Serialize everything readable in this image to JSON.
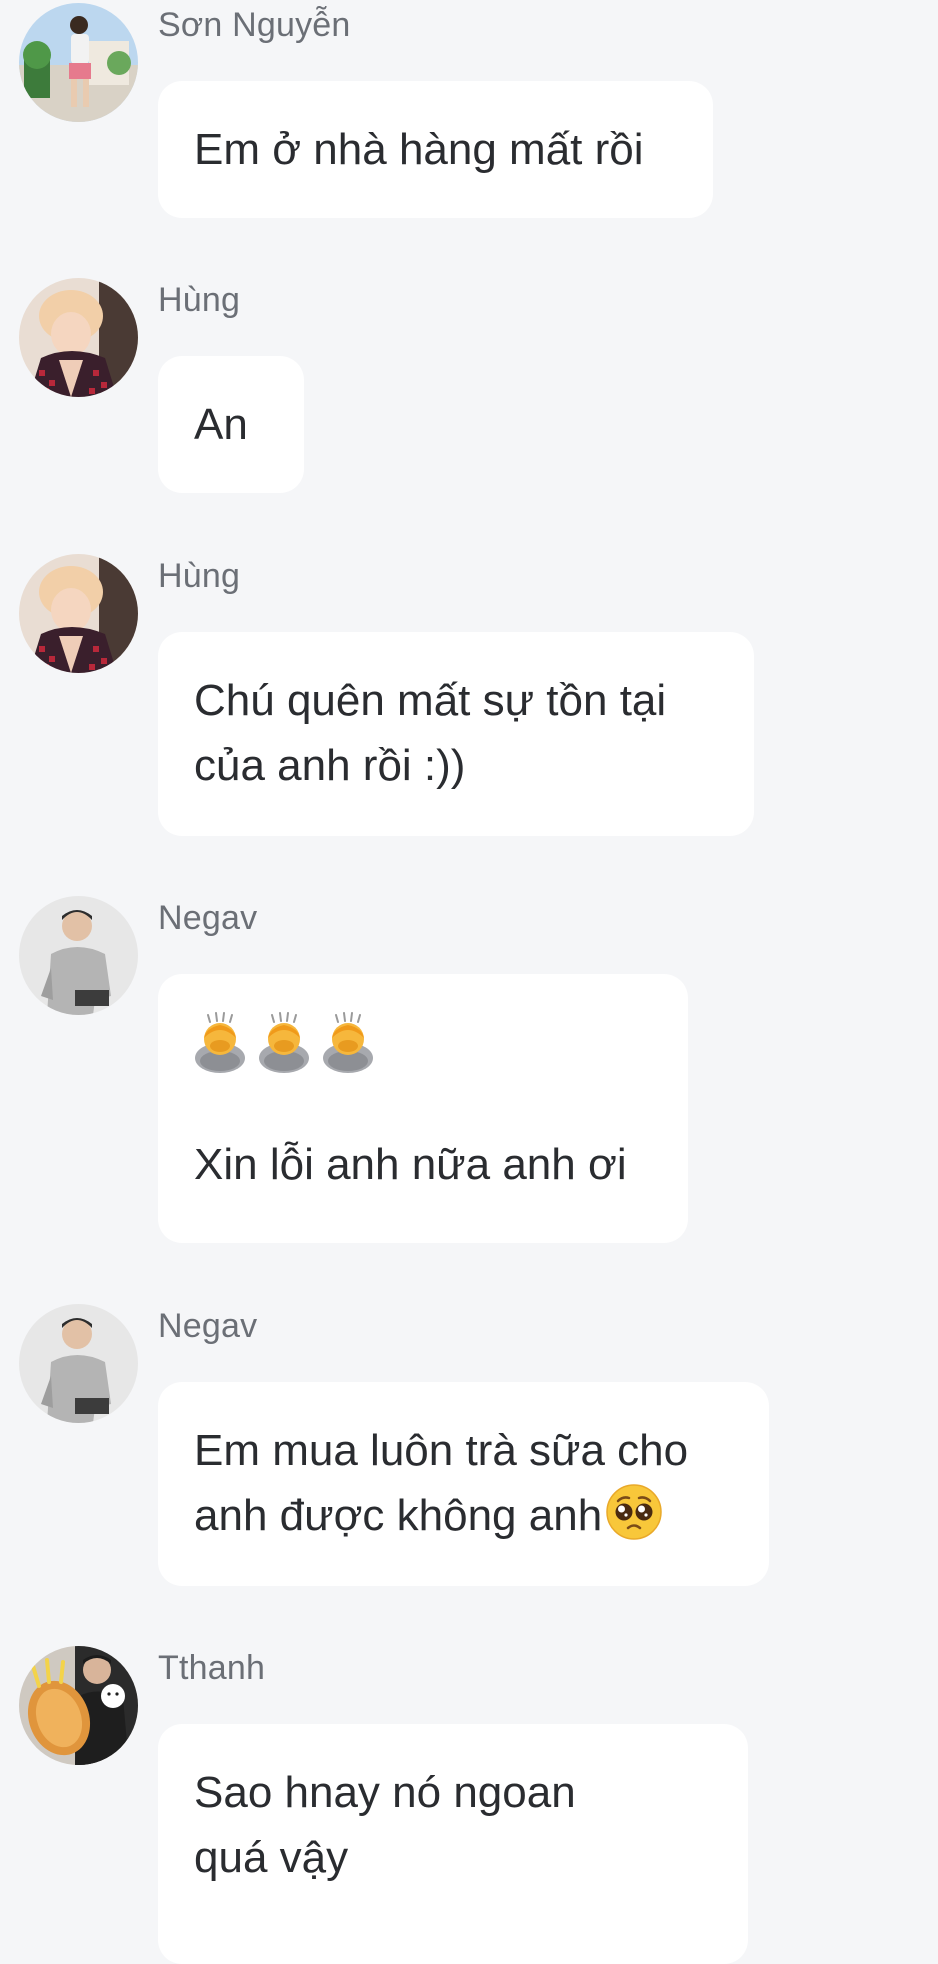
{
  "messages": [
    {
      "sender": "Sơn Nguyễn",
      "avatar": "avatar-photo-son-nguyen",
      "lines": [
        "Em ở nhà hàng mất rồi"
      ]
    },
    {
      "sender": "Hùng",
      "avatar": "avatar-photo-hung",
      "lines": [
        "An"
      ]
    },
    {
      "sender": "Hùng",
      "avatar": "avatar-photo-hung",
      "lines": [
        "Chú quên mất sự tồn tại",
        "của anh rồi :))"
      ]
    },
    {
      "sender": "Negav",
      "avatar": "avatar-photo-negav",
      "emoji_row": [
        "person-bowing-emoji",
        "person-bowing-emoji",
        "person-bowing-emoji"
      ],
      "lines": [
        "Xin lỗi anh nữa anh ơi"
      ]
    },
    {
      "sender": "Negav",
      "avatar": "avatar-photo-negav",
      "lines": [
        "Em mua luôn trà sữa cho",
        "anh được không anh"
      ],
      "trailing_emoji": "pleading-face-emoji"
    },
    {
      "sender": "Tthanh",
      "avatar": "avatar-photo-tthanh",
      "lines": [
        "Sao hnay nó ngoan",
        "quá vậy"
      ]
    }
  ]
}
